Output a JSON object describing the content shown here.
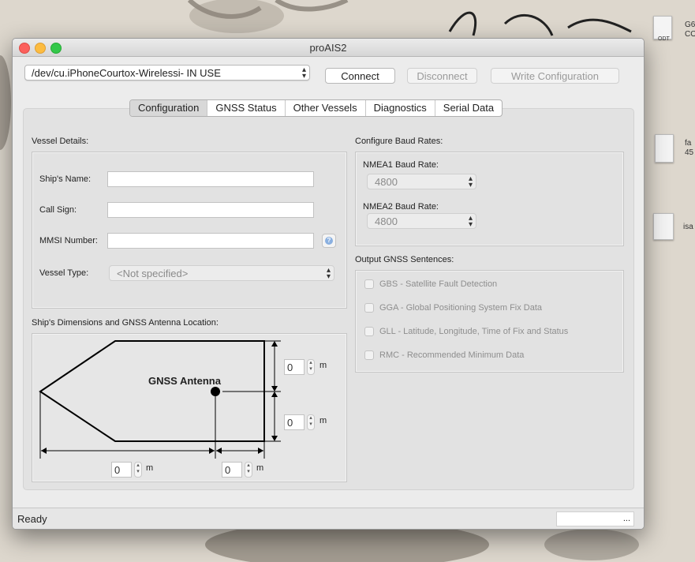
{
  "window": {
    "title": "proAIS2"
  },
  "toolbar": {
    "port": "/dev/cu.iPhoneCourtox-Wirelessi- IN USE",
    "connect_label": "Connect",
    "disconnect_label": "Disconnect",
    "write_label": "Write Configuration"
  },
  "tabs": [
    "Configuration",
    "GNSS Status",
    "Other Vessels",
    "Diagnostics",
    "Serial Data"
  ],
  "vessel": {
    "section_label": "Vessel Details:",
    "name_label": "Ship's Name:",
    "name_value": "",
    "callsign_label": "Call Sign:",
    "callsign_value": "",
    "mmsi_label": "MMSI Number:",
    "mmsi_value": "",
    "help_icon": "?",
    "type_label": "Vessel Type:",
    "type_value": "<Not specified>"
  },
  "dimensions": {
    "section_label": "Ship's Dimensions and GNSS Antenna Location:",
    "antenna_label": "GNSS Antenna",
    "unit": "m",
    "top_value": "0",
    "bottom_value": "0",
    "left_value": "0",
    "right_value": "0"
  },
  "baud": {
    "section_label": "Configure Baud Rates:",
    "nmea1_label": "NMEA1 Baud Rate:",
    "nmea1_value": "4800",
    "nmea2_label": "NMEA2 Baud Rate:",
    "nmea2_value": "4800"
  },
  "gnss": {
    "section_label": "Output GNSS Sentences:",
    "sentences": [
      "GBS - Satellite Fault Detection",
      "GGA - Global Positioning System Fix Data",
      "GLL - Latitude, Longitude, Time of Fix and Status",
      "RMC - Recommended Minimum Data"
    ]
  },
  "status": {
    "text": "Ready",
    "field": "..."
  },
  "desktop": {
    "icon_labels": [
      "G6",
      "CO",
      "ODT",
      "fa",
      "45",
      "isa"
    ]
  }
}
